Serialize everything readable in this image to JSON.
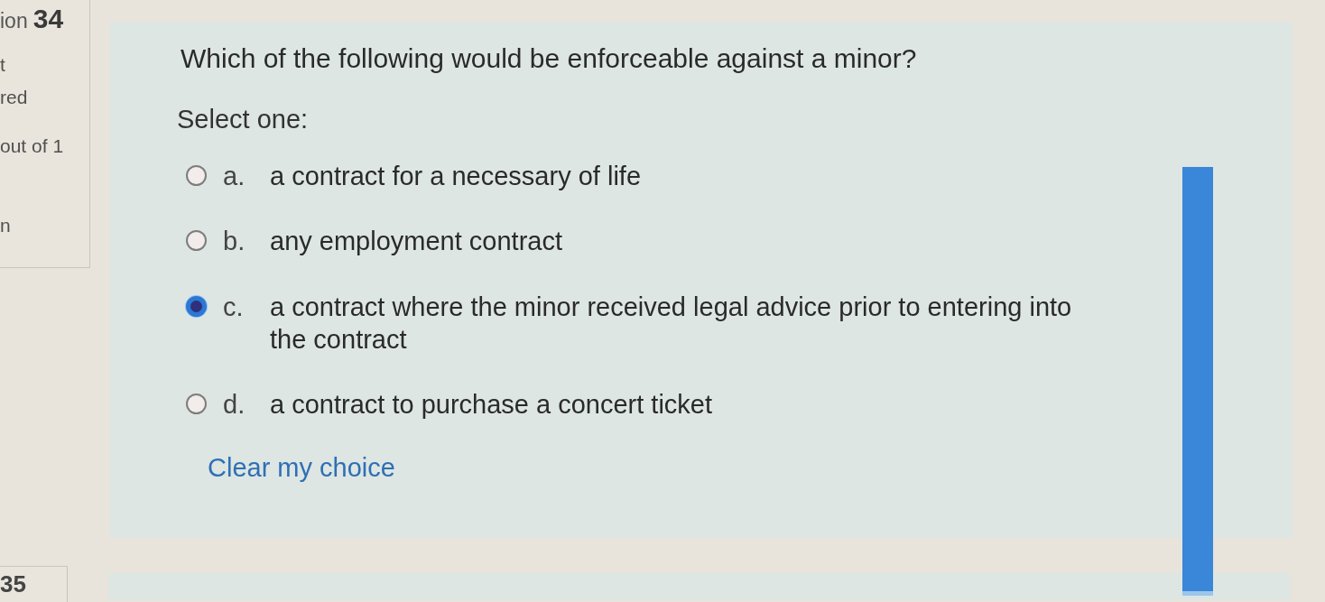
{
  "sidebar": {
    "question_label": "ion",
    "question_number": "34",
    "status_lines": [
      "t",
      "red"
    ],
    "marks": "out of 1",
    "flag": "n"
  },
  "question": {
    "text": "Which of the following would be enforceable against a minor?",
    "prompt": "Select one:",
    "options": [
      {
        "letter": "a.",
        "text": "a contract for a necessary of life",
        "selected": false
      },
      {
        "letter": "b.",
        "text": "any employment contract",
        "selected": false
      },
      {
        "letter": "c.",
        "text": "a contract where the minor received legal advice prior to entering into the contract",
        "selected": true
      },
      {
        "letter": "d.",
        "text": "a contract to purchase a concert ticket",
        "selected": false
      }
    ],
    "clear_link": "Clear my choice"
  },
  "next_question": {
    "number": "35"
  }
}
